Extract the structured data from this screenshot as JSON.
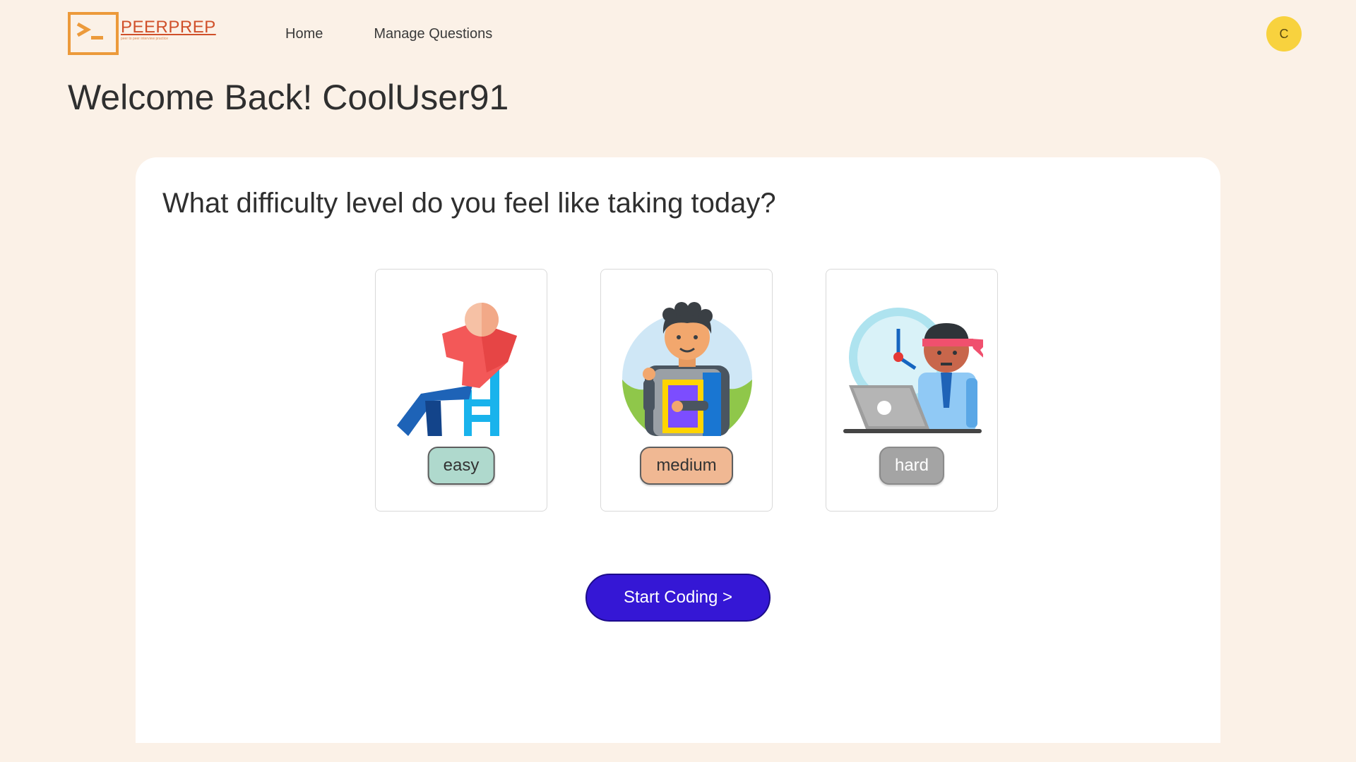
{
  "app": {
    "logo_text": "PEERPREP",
    "logo_tagline": "peer to peer interview practice"
  },
  "nav": {
    "items": [
      {
        "label": "Home"
      },
      {
        "label": "Manage Questions"
      }
    ],
    "avatar_initial": "C"
  },
  "welcome": {
    "title": "Welcome Back! CoolUser91"
  },
  "difficulty": {
    "question": "What difficulty level do you feel like taking today?",
    "options": [
      {
        "label": "easy",
        "icon": "relaxing-person-icon",
        "color": "#afd9cd"
      },
      {
        "label": "medium",
        "icon": "student-with-book-icon",
        "color": "#f0b893"
      },
      {
        "label": "hard",
        "icon": "stressed-worker-clock-icon",
        "color": "#a4a4a4"
      }
    ]
  },
  "actions": {
    "start_label": "Start Coding >"
  },
  "colors": {
    "background": "#fbf1e7",
    "accent": "#3517d5",
    "logo": "#ec9a3b",
    "avatar": "#f8d23e"
  }
}
